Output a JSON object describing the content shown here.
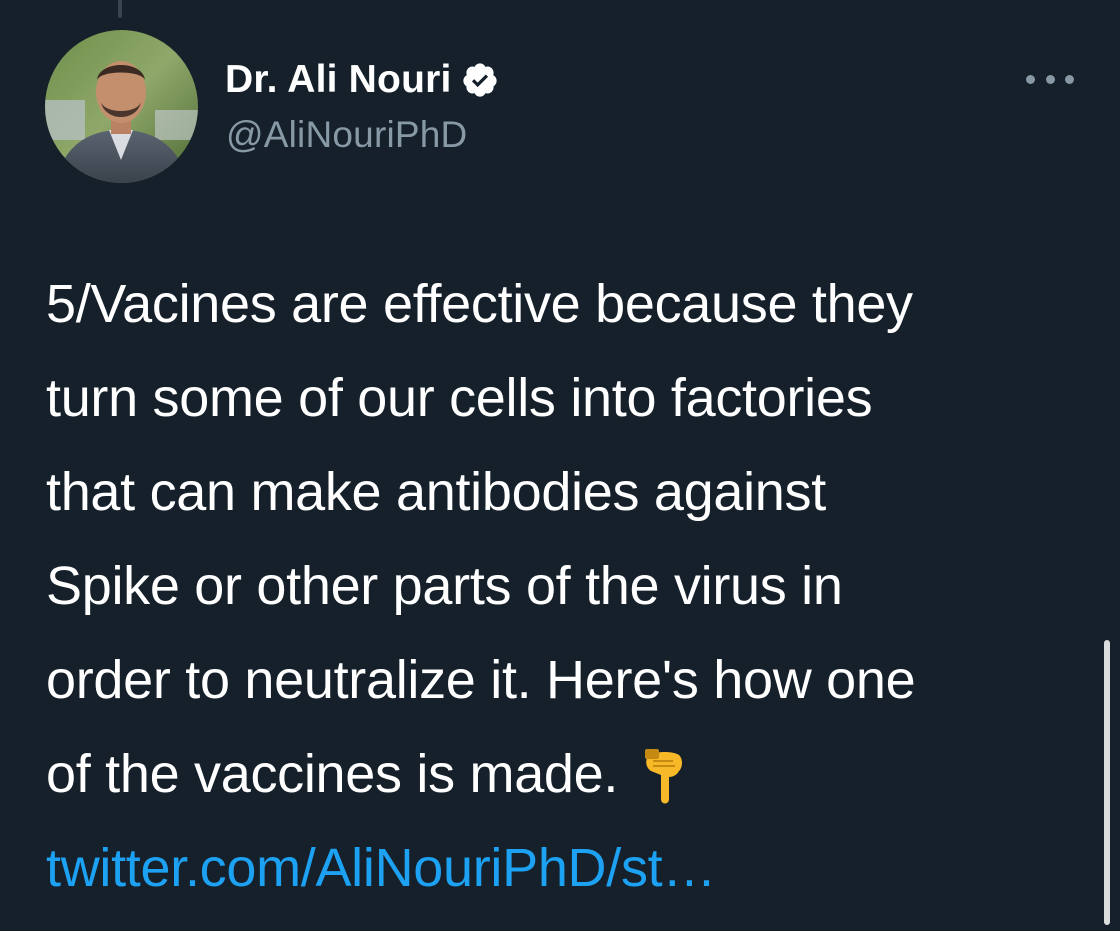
{
  "tweet": {
    "author": {
      "display_name": "Dr. Ali Nouri",
      "handle": "@AliNouriPhD",
      "verified": true,
      "avatar_icon": "profile-photo"
    },
    "more_icon": "more-horizontal-icon",
    "text_lines": [
      "5/Vacines are effective because they",
      "turn some of our cells into factories",
      "that can make antibodies against",
      "Spike or other parts of the virus in",
      "order to neutralize it. Here's how one",
      "of the vaccines is made."
    ],
    "emoji": "backhand-index-pointing-down",
    "link_text": "twitter.com/AliNouriPhD/st…"
  },
  "colors": {
    "background": "#15202b",
    "text": "#ffffff",
    "secondary_text": "#8899a6",
    "link": "#1da1f2",
    "verified_badge": "#ffffff"
  }
}
